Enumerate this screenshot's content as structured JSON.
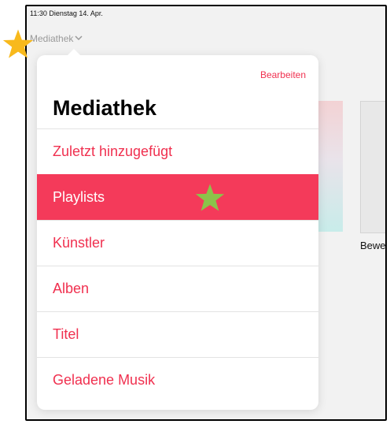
{
  "status_bar": {
    "time_date": "11:30  Dienstag 14. Apr."
  },
  "nav": {
    "title": "Mediathek",
    "chevron": "chevron-down-icon"
  },
  "background": {
    "card_label": "Bewe"
  },
  "popover": {
    "edit_label": "Bearbeiten",
    "title": "Mediathek",
    "items": [
      {
        "label": "Zuletzt hinzugefügt",
        "selected": false
      },
      {
        "label": "Playlists",
        "selected": true
      },
      {
        "label": "Künstler",
        "selected": false
      },
      {
        "label": "Alben",
        "selected": false
      },
      {
        "label": "Titel",
        "selected": false
      },
      {
        "label": "Geladene Musik",
        "selected": false
      }
    ]
  },
  "markers": [
    {
      "name": "star-icon",
      "color": "#f8b91c"
    },
    {
      "name": "star-icon",
      "color": "#8bc34a"
    }
  ],
  "colors": {
    "accent": "#f0304f",
    "selected_bg": "#f43a5a"
  }
}
